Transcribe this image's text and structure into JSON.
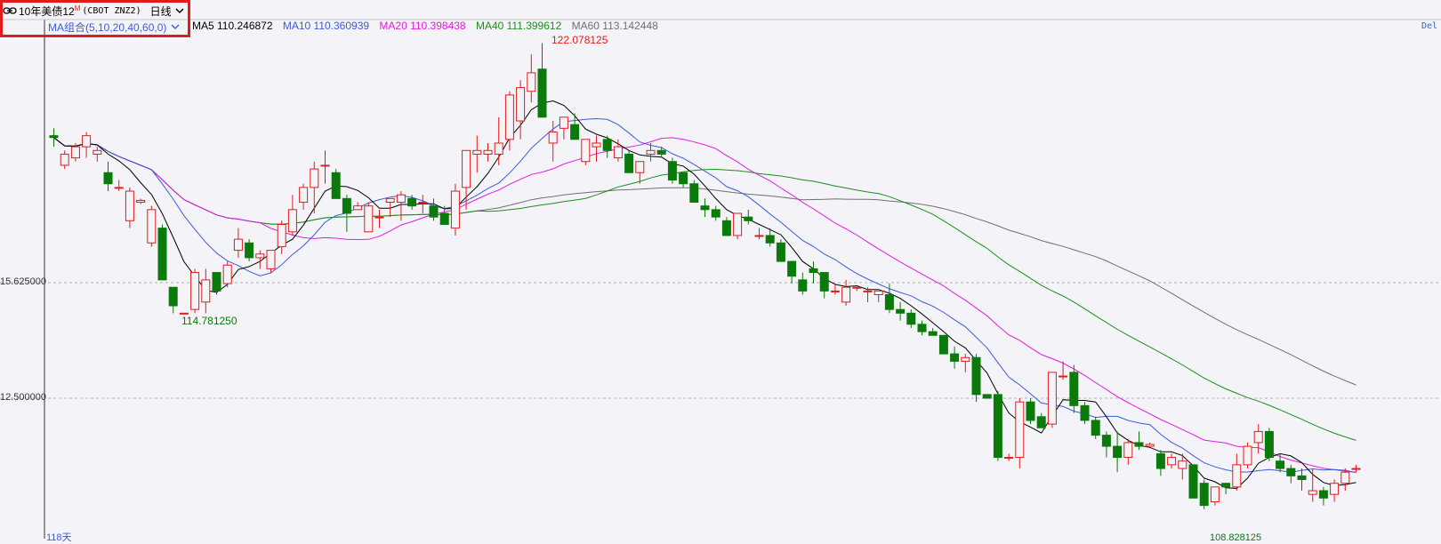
{
  "header": {
    "instrument": "10年美债12",
    "badge": "M",
    "code": "(CBOT ZNZ2)",
    "period": "日线",
    "ma_combo": "MA组合(5,10,20,40,60,0)",
    "del_label": "Del",
    "icon": "link-icon"
  },
  "ma_legend": [
    {
      "label": "MA5 110.246872",
      "color": "#000000"
    },
    {
      "label": "MA10 110.360939",
      "color": "#3b5bdb"
    },
    {
      "label": "MA20 110.398438",
      "color": "#e619e6"
    },
    {
      "label": "MA40 111.399612",
      "color": "#1a8f1a"
    },
    {
      "label": "MA60 113.142448",
      "color": "#707070"
    }
  ],
  "y_axis": {
    "labels": [
      "15.625000",
      "12.500000"
    ]
  },
  "annotations": {
    "high_label": "122.078125",
    "low_label": "114.781250",
    "bottom_partial": "118天",
    "bottom_low_partial": "108.828125"
  },
  "colors": {
    "up": "#e31b1b",
    "down": "#0a7a0a",
    "background": "#f4f4f8",
    "grid": "#b0b0b0"
  },
  "chart_data": {
    "type": "candlestick",
    "candles": [
      [
        119.6,
        119.8,
        119.3,
        119.55
      ],
      [
        118.8,
        119.2,
        118.7,
        119.1
      ],
      [
        119.0,
        119.4,
        118.9,
        119.3
      ],
      [
        119.3,
        119.7,
        119.0,
        119.6
      ],
      [
        119.1,
        119.3,
        118.9,
        119.2
      ],
      [
        118.6,
        118.9,
        118.1,
        118.3
      ],
      [
        118.2,
        118.4,
        118.1,
        118.2
      ],
      [
        117.3,
        118.2,
        117.1,
        118.1
      ],
      [
        117.8,
        117.9,
        117.75,
        117.85
      ],
      [
        116.7,
        117.7,
        116.6,
        117.6
      ],
      [
        117.1,
        117.2,
        115.7,
        115.7
      ],
      [
        115.5,
        115.5,
        114.8,
        115.0
      ],
      [
        114.8,
        114.8,
        114.8,
        114.8
      ],
      [
        114.9,
        116.0,
        114.8,
        115.9
      ],
      [
        115.1,
        116.0,
        114.8,
        115.7
      ],
      [
        115.9,
        115.9,
        115.3,
        115.4
      ],
      [
        115.6,
        116.2,
        115.5,
        116.1
      ],
      [
        116.5,
        117.1,
        116.3,
        116.8
      ],
      [
        116.7,
        116.8,
        116.2,
        116.3
      ],
      [
        116.3,
        116.5,
        116.0,
        116.4
      ],
      [
        116.0,
        116.5,
        115.9,
        116.5
      ],
      [
        116.6,
        117.3,
        116.4,
        117.2
      ],
      [
        117.0,
        118.0,
        116.9,
        117.6
      ],
      [
        117.8,
        118.3,
        117.6,
        118.2
      ],
      [
        118.2,
        118.9,
        117.5,
        118.7
      ],
      [
        118.8,
        119.2,
        118.3,
        118.8
      ],
      [
        118.6,
        118.7,
        117.9,
        117.9
      ],
      [
        117.9,
        118.0,
        117.0,
        117.5
      ],
      [
        117.6,
        117.8,
        117.6,
        117.7
      ],
      [
        117.0,
        117.8,
        117.0,
        117.7
      ],
      [
        117.4,
        117.6,
        117.1,
        117.4
      ],
      [
        117.8,
        117.9,
        117.4,
        117.9
      ],
      [
        117.8,
        118.1,
        117.3,
        118.0
      ],
      [
        117.9,
        118.0,
        117.6,
        117.7
      ],
      [
        117.8,
        118.0,
        117.5,
        117.8
      ],
      [
        117.7,
        117.9,
        117.3,
        117.4
      ],
      [
        117.5,
        117.7,
        117.2,
        117.2
      ],
      [
        117.1,
        118.3,
        116.9,
        118.1
      ],
      [
        118.2,
        119.2,
        117.6,
        119.2
      ],
      [
        119.1,
        119.6,
        118.6,
        119.2
      ],
      [
        119.1,
        119.4,
        118.9,
        119.2
      ],
      [
        119.1,
        120.1,
        118.8,
        119.4
      ],
      [
        119.5,
        120.8,
        119.2,
        120.7
      ],
      [
        120.0,
        121.1,
        119.5,
        120.9
      ],
      [
        120.8,
        121.8,
        120.5,
        121.3
      ],
      [
        121.4,
        122.1,
        120.6,
        120.1
      ],
      [
        119.4,
        120.0,
        118.9,
        119.7
      ],
      [
        119.8,
        120.1,
        119.5,
        120.1
      ],
      [
        119.9,
        120.2,
        119.6,
        119.5
      ],
      [
        118.9,
        119.5,
        118.8,
        119.5
      ],
      [
        119.3,
        119.6,
        118.9,
        119.4
      ],
      [
        119.5,
        119.6,
        119.0,
        119.2
      ],
      [
        119.0,
        119.5,
        118.9,
        119.3
      ],
      [
        119.1,
        119.2,
        118.6,
        118.6
      ],
      [
        118.6,
        118.9,
        118.3,
        118.9
      ],
      [
        119.1,
        119.4,
        118.9,
        119.2
      ],
      [
        119.2,
        119.3,
        119.0,
        119.1
      ],
      [
        118.9,
        119.0,
        118.3,
        118.4
      ],
      [
        118.6,
        118.6,
        118.2,
        118.3
      ],
      [
        118.3,
        118.4,
        117.8,
        117.8
      ],
      [
        117.7,
        117.9,
        117.4,
        117.6
      ],
      [
        117.6,
        117.7,
        117.3,
        117.4
      ],
      [
        117.3,
        117.4,
        116.9,
        116.9
      ],
      [
        116.9,
        117.5,
        116.8,
        117.5
      ],
      [
        117.4,
        117.6,
        117.2,
        117.3
      ],
      [
        116.9,
        117.1,
        116.8,
        116.9
      ],
      [
        116.9,
        117.1,
        116.6,
        116.7
      ],
      [
        116.7,
        116.8,
        116.2,
        116.2
      ],
      [
        116.2,
        116.2,
        115.6,
        115.8
      ],
      [
        115.7,
        115.9,
        115.3,
        115.4
      ],
      [
        116.0,
        116.2,
        115.6,
        115.9
      ],
      [
        115.9,
        115.9,
        115.2,
        115.4
      ],
      [
        115.4,
        115.6,
        115.3,
        115.4
      ],
      [
        115.1,
        115.7,
        115.0,
        115.5
      ],
      [
        115.5,
        115.5,
        115.4,
        115.5
      ],
      [
        115.4,
        115.5,
        115.1,
        115.4
      ],
      [
        115.3,
        115.4,
        115.1,
        115.4
      ],
      [
        115.3,
        115.6,
        114.8,
        114.9
      ],
      [
        114.9,
        115.1,
        114.6,
        114.8
      ],
      [
        114.8,
        114.9,
        114.4,
        114.5
      ],
      [
        114.5,
        114.6,
        114.2,
        114.3
      ],
      [
        114.3,
        114.4,
        114.2,
        114.2
      ],
      [
        114.2,
        114.2,
        113.7,
        113.7
      ],
      [
        113.7,
        113.9,
        113.3,
        113.5
      ],
      [
        113.5,
        113.7,
        113.2,
        113.6
      ],
      [
        113.6,
        113.7,
        112.4,
        112.6
      ],
      [
        112.6,
        112.6,
        112.5,
        112.5
      ],
      [
        112.6,
        112.7,
        110.8,
        110.9
      ],
      [
        110.9,
        111.0,
        110.8,
        110.9
      ],
      [
        110.9,
        112.5,
        110.6,
        112.4
      ],
      [
        112.4,
        112.5,
        111.8,
        111.9
      ],
      [
        112.0,
        112.1,
        111.7,
        111.7
      ],
      [
        111.8,
        113.2,
        111.7,
        113.2
      ],
      [
        113.1,
        113.5,
        113.0,
        113.1
      ],
      [
        113.2,
        113.4,
        112.1,
        112.3
      ],
      [
        112.3,
        112.4,
        111.8,
        111.9
      ],
      [
        111.9,
        112.0,
        111.4,
        111.5
      ],
      [
        111.5,
        111.6,
        110.9,
        111.2
      ],
      [
        111.2,
        111.6,
        110.5,
        110.9
      ],
      [
        110.9,
        111.4,
        110.7,
        111.3
      ],
      [
        111.3,
        111.6,
        111.1,
        111.2
      ],
      [
        111.2,
        111.3,
        111.2,
        111.25
      ],
      [
        111.0,
        111.1,
        110.4,
        110.6
      ],
      [
        110.7,
        111.0,
        110.6,
        110.9
      ],
      [
        110.6,
        111.0,
        110.3,
        110.8
      ],
      [
        110.7,
        110.7,
        109.8,
        109.8
      ],
      [
        110.2,
        110.3,
        109.5,
        109.6
      ],
      [
        109.7,
        110.1,
        109.6,
        110.1
      ],
      [
        110.2,
        110.2,
        109.9,
        110.1
      ],
      [
        110.1,
        111.0,
        110.0,
        110.7
      ],
      [
        110.7,
        111.3,
        110.6,
        111.2
      ],
      [
        111.3,
        111.8,
        111.0,
        111.6
      ],
      [
        111.6,
        111.7,
        110.8,
        110.9
      ],
      [
        110.8,
        111.0,
        110.5,
        110.6
      ],
      [
        110.6,
        110.7,
        110.2,
        110.4
      ],
      [
        110.4,
        110.6,
        110.0,
        110.3
      ],
      [
        109.9,
        110.6,
        109.7,
        110.0
      ],
      [
        110.0,
        110.1,
        109.6,
        109.8
      ],
      [
        109.9,
        110.3,
        109.7,
        110.2
      ],
      [
        110.2,
        110.6,
        110.0,
        110.5
      ],
      [
        110.6,
        110.7,
        110.5,
        110.6
      ]
    ],
    "y_ticks": [
      115.625,
      112.5
    ],
    "high_value": 122.078125,
    "low_value": 114.78125
  }
}
